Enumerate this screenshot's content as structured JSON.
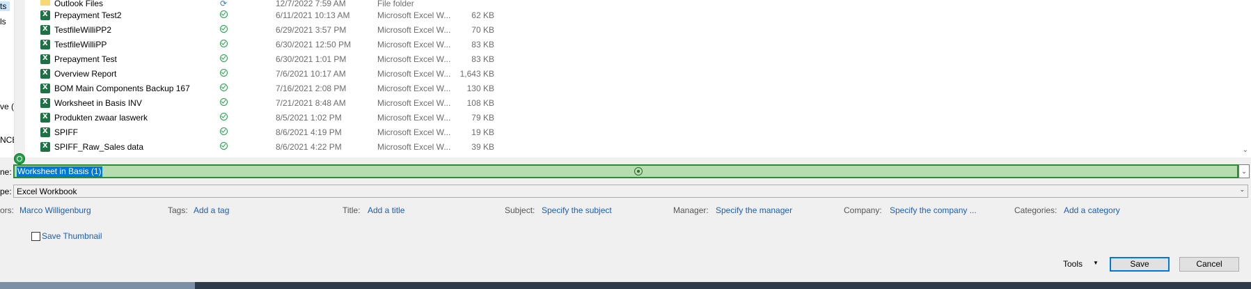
{
  "nav": {
    "items": [
      {
        "label": "ts",
        "selected": true
      },
      {
        "label": "ls",
        "selected": false
      },
      {
        "label": "ve (H",
        "selected": false
      },
      {
        "label": "NCE",
        "selected": false
      }
    ]
  },
  "files": [
    {
      "name": "Outlook Files",
      "status": "sync",
      "date": "12/7/2022 7:59 AM",
      "type": "File folder",
      "size": "",
      "icon": "folder-icon"
    },
    {
      "name": "Prepayment Test2",
      "status": "available",
      "date": "6/11/2021 10:13 AM",
      "type": "Microsoft Excel W...",
      "size": "62 KB",
      "icon": "excel-icon"
    },
    {
      "name": "TestfileWilliPP2",
      "status": "available",
      "date": "6/29/2021 3:57 PM",
      "type": "Microsoft Excel W...",
      "size": "70 KB",
      "icon": "excel-icon"
    },
    {
      "name": "TestfileWilliPP",
      "status": "available",
      "date": "6/30/2021 12:50 PM",
      "type": "Microsoft Excel W...",
      "size": "83 KB",
      "icon": "excel-icon"
    },
    {
      "name": "Prepayment Test",
      "status": "available",
      "date": "6/30/2021 1:01 PM",
      "type": "Microsoft Excel W...",
      "size": "83 KB",
      "icon": "excel-icon"
    },
    {
      "name": "Overview Report",
      "status": "available",
      "date": "7/6/2021 10:17 AM",
      "type": "Microsoft Excel W...",
      "size": "1,643 KB",
      "icon": "excel-icon"
    },
    {
      "name": "BOM Main Components Backup 167",
      "status": "available",
      "date": "7/16/2021 2:08 PM",
      "type": "Microsoft Excel W...",
      "size": "130 KB",
      "icon": "excel-icon"
    },
    {
      "name": "Worksheet in Basis INV",
      "status": "available",
      "date": "7/21/2021 8:48 AM",
      "type": "Microsoft Excel W...",
      "size": "108 KB",
      "icon": "excel-icon"
    },
    {
      "name": "Produkten zwaar laswerk",
      "status": "available",
      "date": "8/5/2021 1:02 PM",
      "type": "Microsoft Excel W...",
      "size": "79 KB",
      "icon": "excel-icon"
    },
    {
      "name": "SPIFF",
      "status": "available",
      "date": "8/6/2021 4:19 PM",
      "type": "Microsoft Excel W...",
      "size": "19 KB",
      "icon": "excel-icon"
    },
    {
      "name": "SPIFF_Raw_Sales data",
      "status": "available",
      "date": "8/6/2021 4:22 PM",
      "type": "Microsoft Excel W...",
      "size": "39 KB",
      "icon": "excel-icon"
    }
  ],
  "form": {
    "filename_label": "ne:",
    "filename_value": "Worksheet in Basis (1)",
    "type_label": "pe:",
    "type_value": "Excel Workbook"
  },
  "meta": {
    "authors_label": "ors:",
    "authors_value": "Marco Willigenburg",
    "tags_label": "Tags:",
    "tags_value": "Add a tag",
    "title_label": "Title:",
    "title_value": "Add a title",
    "subject_label": "Subject:",
    "subject_value": "Specify the subject",
    "manager_label": "Manager:",
    "manager_value": "Specify the manager",
    "company_label": "Company:",
    "company_value": "Specify the company ...",
    "categories_label": "Categories:",
    "categories_value": "Add a category"
  },
  "thumbnail": {
    "label": "Save Thumbnail",
    "checked": false
  },
  "buttons": {
    "tools": "Tools",
    "save": "Save",
    "cancel": "Cancel"
  },
  "colors": {
    "selection": "#0078d7",
    "filename_highlight": "#b6ddb0",
    "link": "#1a5fb4",
    "excel": "#1e7145"
  }
}
